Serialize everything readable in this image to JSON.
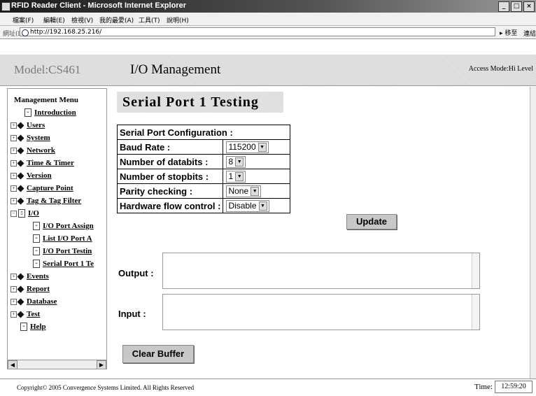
{
  "window": {
    "title": "RFID Reader Client - Microsoft Internet Explorer"
  },
  "menu": [
    "檔案(F)",
    "編輯(E)",
    "檢視(V)",
    "我的最愛(A)",
    "工具(T)",
    "說明(H)"
  ],
  "address": {
    "label": "網址(D)",
    "url": "http://192.168.25.216/",
    "go_label": "移至",
    "links_label": "連結"
  },
  "header": {
    "model": "Model:CS461",
    "page_heading": "I/O Management",
    "access_mode": "Access Mode:Hi Level"
  },
  "sidebar": {
    "title": "Management Menu",
    "items": [
      {
        "label": "Introduction"
      },
      {
        "label": "Users"
      },
      {
        "label": "System"
      },
      {
        "label": "Network"
      },
      {
        "label": "Time & Timer"
      },
      {
        "label": "Version"
      },
      {
        "label": "Capture Point"
      },
      {
        "label": "Tag & Tag Filter"
      },
      {
        "label": "I/O"
      },
      {
        "label": "I/O Port Assign"
      },
      {
        "label": "List I/O Port A"
      },
      {
        "label": "I/O Port Testin"
      },
      {
        "label": "Serial Port 1 Te"
      },
      {
        "label": "Events"
      },
      {
        "label": "Report"
      },
      {
        "label": "Database"
      },
      {
        "label": "Test"
      },
      {
        "label": "Help"
      }
    ]
  },
  "main": {
    "title": "Serial Port 1 Testing",
    "config_header": "Serial Port Configuration :",
    "rows": [
      {
        "label": "Baud Rate :",
        "value": "115200"
      },
      {
        "label": "Number of databits :",
        "value": "8"
      },
      {
        "label": "Number of stopbits :",
        "value": "1"
      },
      {
        "label": "Parity checking :",
        "value": "None"
      },
      {
        "label": "Hardware flow control :",
        "value": "Disable"
      }
    ],
    "update_label": "Update",
    "output_label": "Output :",
    "input_label": "Input :",
    "clear_label": "Clear Buffer"
  },
  "footer": {
    "copyright": "Copyright© 2005 Convergence Systems Limited. All Rights Reserved",
    "time_label": "Time:",
    "time_value": "12:59:20"
  }
}
